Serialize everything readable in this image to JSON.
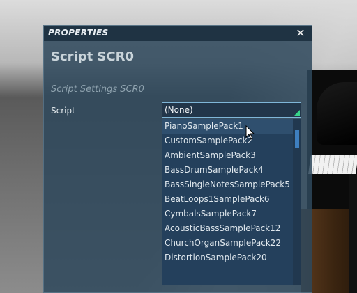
{
  "window": {
    "title": "PROPERTIES",
    "close_glyph": "✕"
  },
  "header": {
    "script_title": "Script SCR0",
    "section_title": "Script Settings  SCR0"
  },
  "script_field": {
    "label": "Script",
    "selected_value": "(None)"
  },
  "dropdown": {
    "options": [
      "PianoSamplePack1",
      "CustomSamplePack2",
      "AmbientSamplePack3",
      "BassDrumSamplePack4",
      "BassSingleNotesSamplePack5",
      "BeatLoops1SamplePack6",
      "CymbalsSamplePack7",
      "AcousticBassSamplePack12",
      "ChurchOrganSamplePack22",
      "DistortionSamplePack20"
    ],
    "hovered_index": 0
  },
  "colors": {
    "panel_bg": "#2e485c",
    "dropdown_bg": "#24405c",
    "select_border": "#7fb6d8",
    "resize_indicator": "#37d58a",
    "scroll_thumb": "#3e7fbf"
  },
  "icons": {
    "close": "close-icon",
    "cursor": "mouse-pointer-icon",
    "select_corner": "dropdown-corner-icon"
  }
}
